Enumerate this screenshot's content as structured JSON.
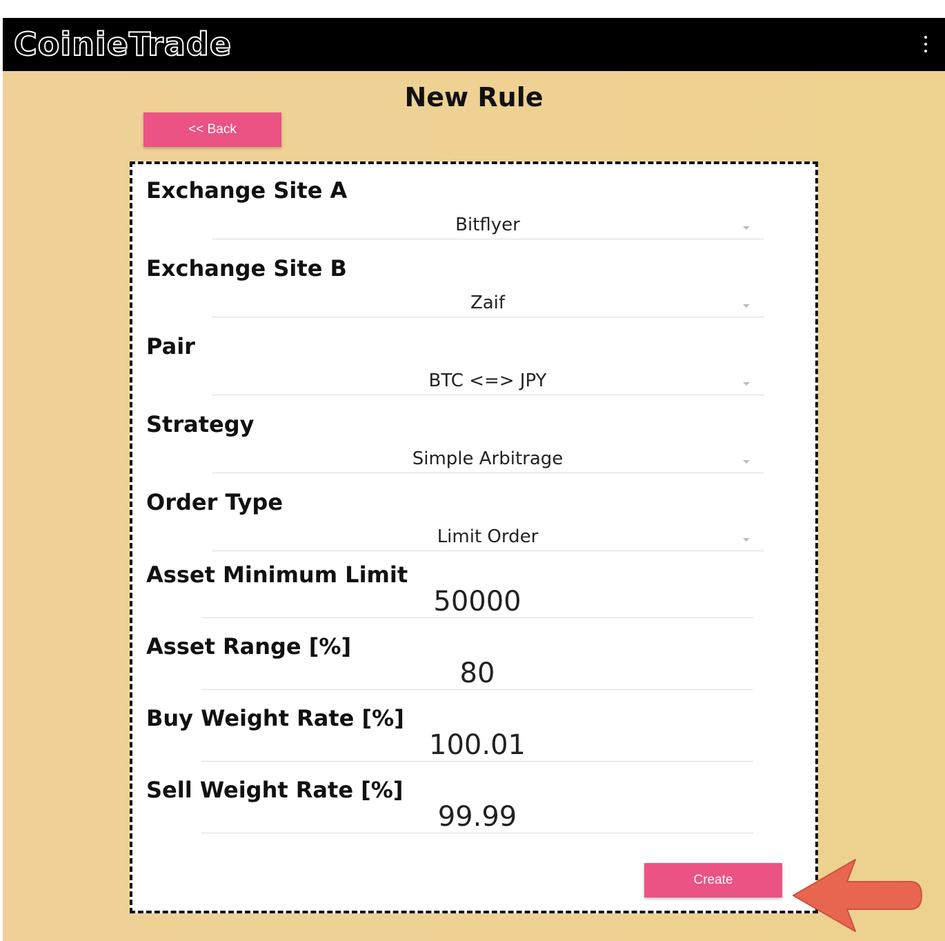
{
  "header": {
    "logo_text": "CoinieTrade",
    "menu_icon": "more-vert-icon"
  },
  "page": {
    "title": "New Rule",
    "back_label": "<< Back",
    "create_label": "Create"
  },
  "form": {
    "exchange_a": {
      "label": "Exchange Site A",
      "value": "Bitflyer"
    },
    "exchange_b": {
      "label": "Exchange Site B",
      "value": "Zaif"
    },
    "pair": {
      "label": "Pair",
      "value": "BTC <=> JPY"
    },
    "strategy": {
      "label": "Strategy",
      "value": "Simple Arbitrage"
    },
    "order_type": {
      "label": "Order Type",
      "value": "Limit Order"
    },
    "asset_min_limit": {
      "label": "Asset Minimum Limit",
      "value": "50000"
    },
    "asset_range": {
      "label": "Asset Range [%]",
      "value": "80"
    },
    "buy_weight_rate": {
      "label": "Buy Weight Rate [%]",
      "value": "100.01"
    },
    "sell_weight_rate": {
      "label": "Sell Weight Rate [%]",
      "value": "99.99"
    }
  },
  "colors": {
    "accent": "#ea5383",
    "background": "#edd18e",
    "header": "#000000",
    "annotation_arrow": "#e8654f"
  }
}
